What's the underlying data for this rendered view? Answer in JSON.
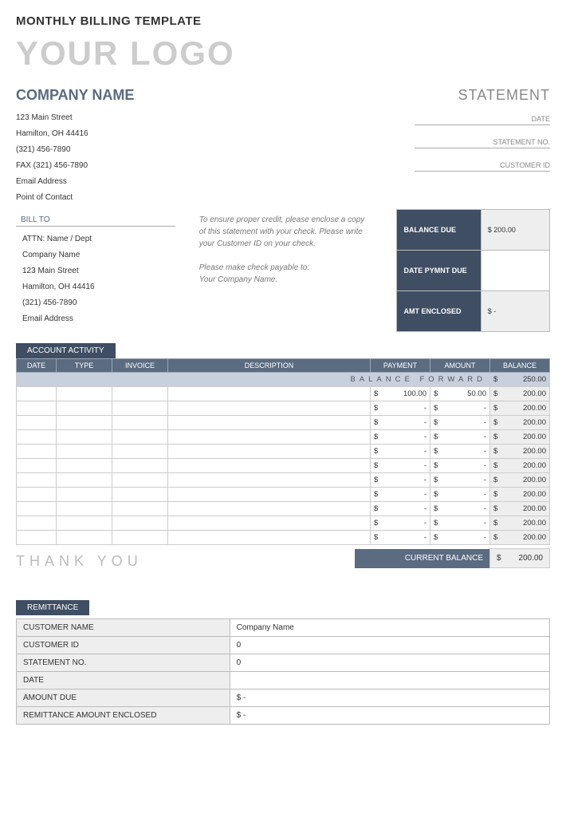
{
  "title": "MONTHLY BILLING TEMPLATE",
  "logo": "YOUR LOGO",
  "companyName": "COMPANY NAME",
  "statementLabel": "STATEMENT",
  "companyInfo": [
    "123 Main Street",
    "Hamilton, OH 44416",
    "(321) 456-7890",
    "FAX (321) 456-7890",
    "Email Address",
    "Point of Contact"
  ],
  "meta": {
    "date": "DATE",
    "statementNo": "STATEMENT NO.",
    "customerId": "CUSTOMER ID"
  },
  "billToHeader": "BILL TO",
  "billTo": [
    "ATTN: Name / Dept",
    "Company Name",
    "123 Main Street",
    "Hamilton, OH  44416",
    "(321) 456-7890",
    "Email Address"
  ],
  "instructions": {
    "p1": "To ensure proper credit, please enclose a copy of this statement with your check. Please write your Customer ID on your check.",
    "p2": "Please make check payable to:",
    "p3": "Your Company Name."
  },
  "summary": {
    "balanceDue": {
      "label": "BALANCE DUE",
      "value": "$      200.00"
    },
    "datePymntDue": {
      "label": "DATE PYMNT DUE",
      "value": ""
    },
    "amtEnclosed": {
      "label": "AMT ENCLOSED",
      "value": "$          -"
    }
  },
  "activity": {
    "tab": "ACCOUNT ACTIVITY",
    "headers": {
      "date": "DATE",
      "type": "TYPE",
      "invoice": "INVOICE",
      "description": "DESCRIPTION",
      "payment": "PAYMENT",
      "amount": "AMOUNT",
      "balance": "BALANCE"
    },
    "balanceForwardLabel": "BALANCE  FORWARD",
    "balanceForward": {
      "sym": "$",
      "val": "250.00"
    },
    "rows": [
      {
        "payment": "100.00",
        "amount": "50.00",
        "balance": "200.00"
      },
      {
        "payment": "-",
        "amount": "-",
        "balance": "200.00"
      },
      {
        "payment": "-",
        "amount": "-",
        "balance": "200.00"
      },
      {
        "payment": "-",
        "amount": "-",
        "balance": "200.00"
      },
      {
        "payment": "-",
        "amount": "-",
        "balance": "200.00"
      },
      {
        "payment": "-",
        "amount": "-",
        "balance": "200.00"
      },
      {
        "payment": "-",
        "amount": "-",
        "balance": "200.00"
      },
      {
        "payment": "-",
        "amount": "-",
        "balance": "200.00"
      },
      {
        "payment": "-",
        "amount": "-",
        "balance": "200.00"
      },
      {
        "payment": "-",
        "amount": "-",
        "balance": "200.00"
      },
      {
        "payment": "-",
        "amount": "-",
        "balance": "200.00"
      }
    ],
    "currentBalanceLabel": "CURRENT BALANCE",
    "currentBalance": {
      "sym": "$",
      "val": "200.00"
    }
  },
  "thankYou": "THANK YOU",
  "remittance": {
    "tab": "REMITTANCE",
    "rows": [
      {
        "label": "CUSTOMER NAME",
        "value": "Company Name"
      },
      {
        "label": "CUSTOMER ID",
        "value": "0"
      },
      {
        "label": "STATEMENT NO.",
        "value": "0"
      },
      {
        "label": "DATE",
        "value": ""
      },
      {
        "label": "AMOUNT DUE",
        "value": "$                                                                                                                  -"
      },
      {
        "label": "REMITTANCE AMOUNT ENCLOSED",
        "value": "$                                                                                                                  -"
      }
    ]
  }
}
